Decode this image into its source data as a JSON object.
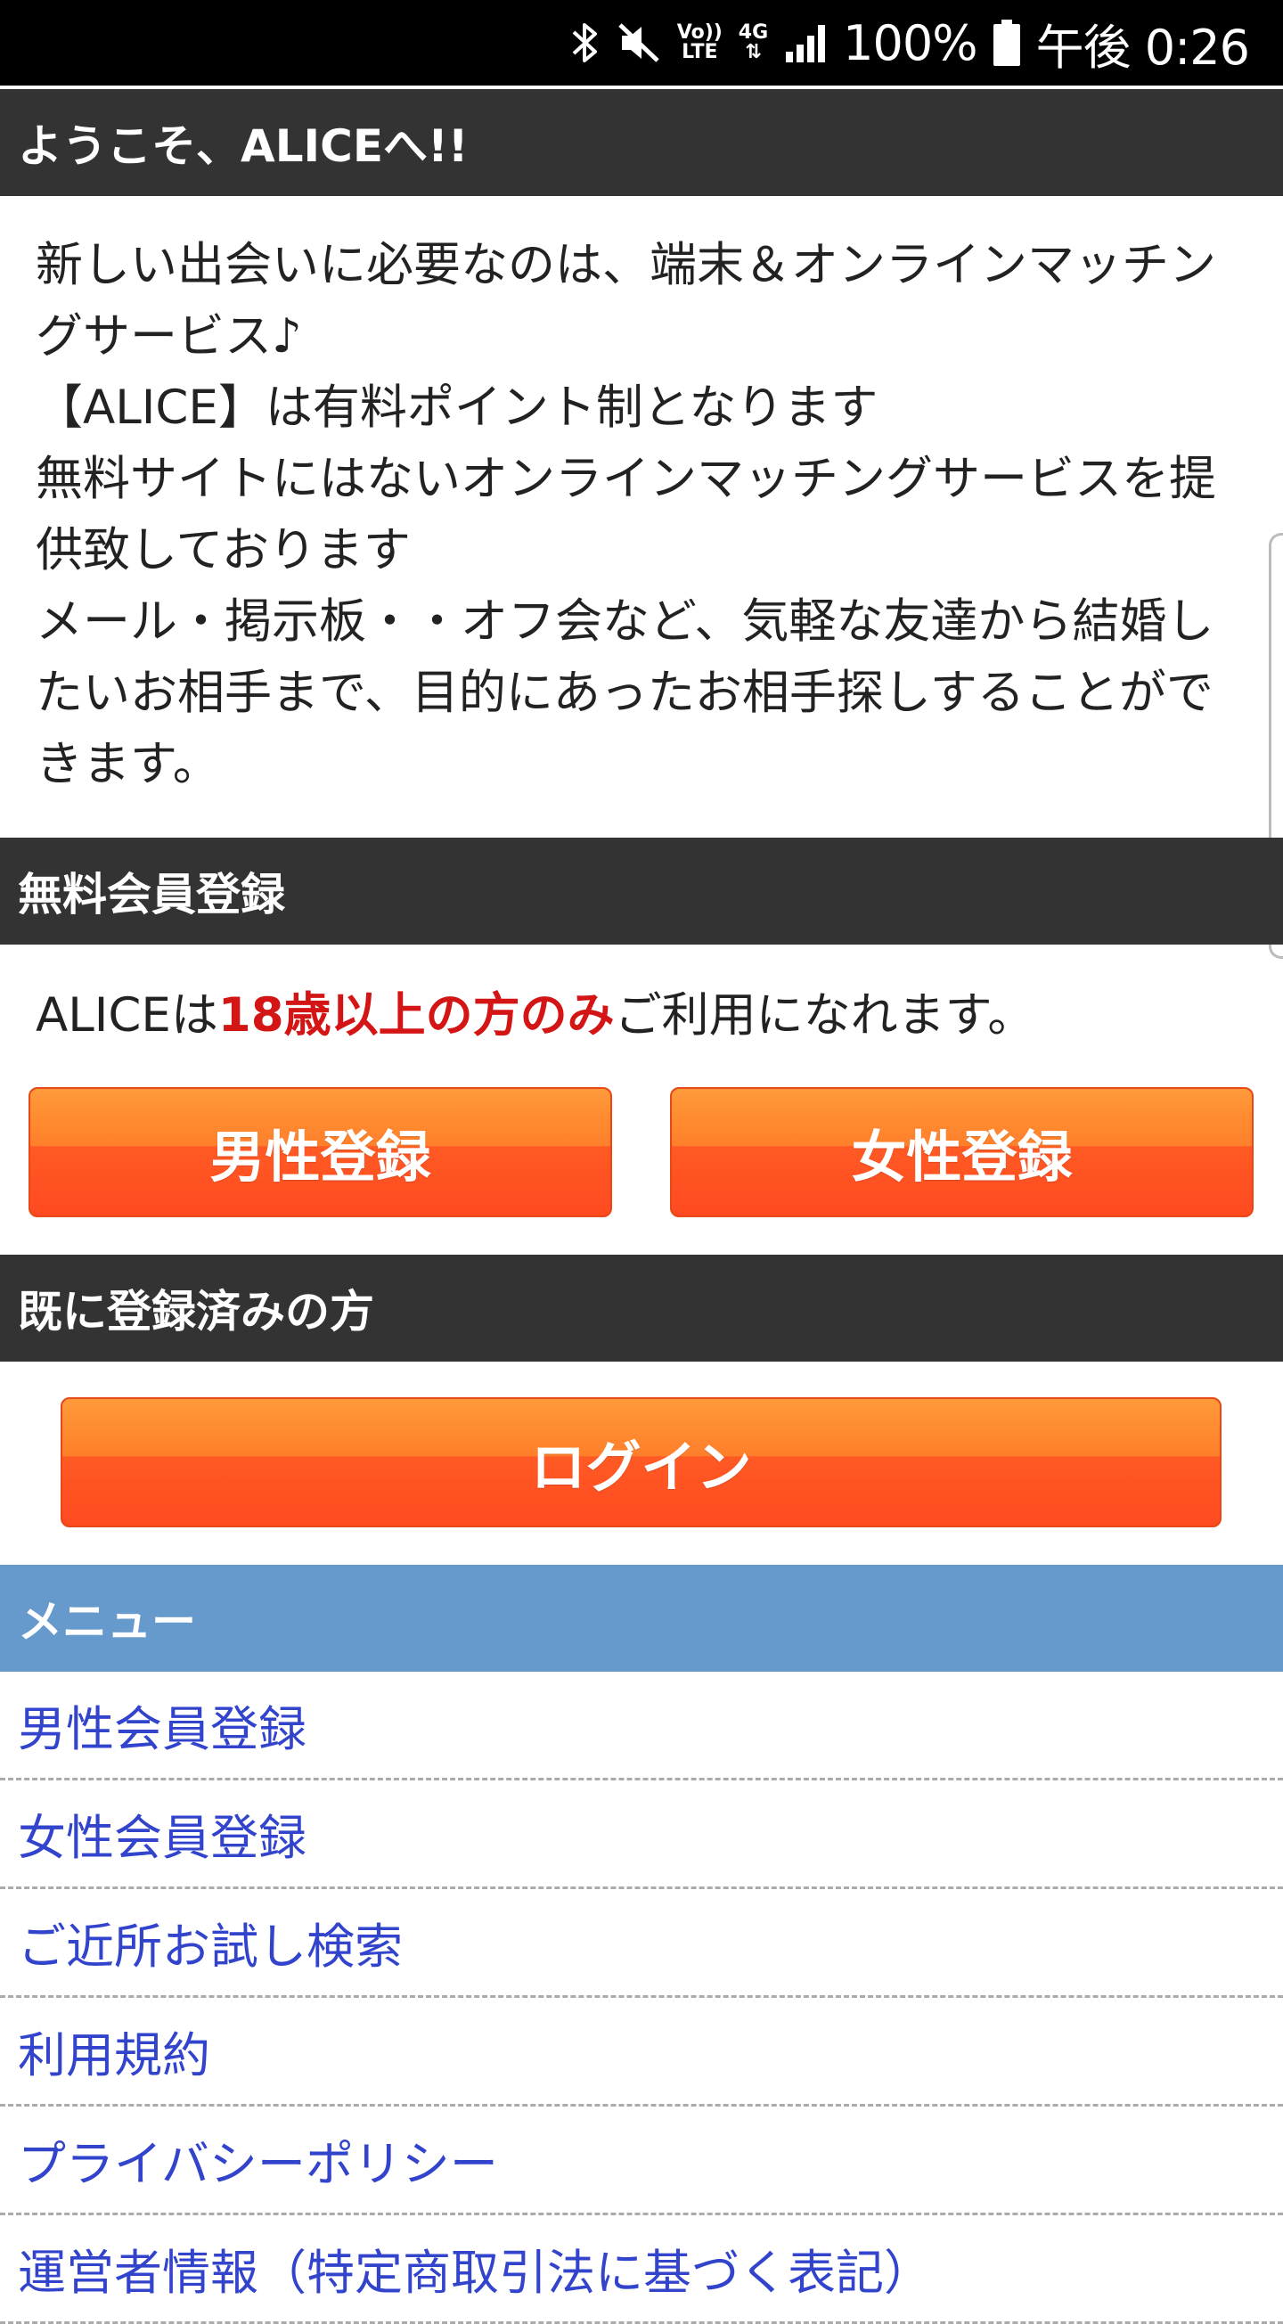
{
  "status_bar": {
    "battery_percent": "100%",
    "time": "午後 0:26",
    "volte_label_top": "Vo))",
    "volte_label_bottom": "LTE",
    "network_label": "4G",
    "icons": [
      "bluetooth-icon",
      "mute-icon",
      "volte-icon",
      "network-4g-icon",
      "signal-icon",
      "battery-icon"
    ]
  },
  "welcome": {
    "header": "ようこそ、ALICEへ!!",
    "paragraphs": [
      "新しい出会いに必要なのは、端末＆オンラインマッチングサービス♪",
      "【ALICE】は有料ポイント制となります",
      "無料サイトにはないオンラインマッチングサービスを提供致しております",
      "メール・掲示板・・オフ会など、気軽な友達から結婚したいお相手まで、目的にあったお相手探しすることができます。"
    ]
  },
  "registration": {
    "header": "無料会員登録",
    "notice_prefix": "ALICEは",
    "notice_highlight": "18歳以上の方のみ",
    "notice_suffix": "ご利用になれます。",
    "male_button": "男性登録",
    "female_button": "女性登録"
  },
  "login": {
    "header": "既に登録済みの方",
    "button": "ログイン"
  },
  "menu": {
    "header": "メニュー",
    "items": [
      "男性会員登録",
      "女性会員登録",
      "ご近所お試し検索",
      "利用規約",
      "プライバシーポリシー",
      "運営者情報（特定商取引法に基づく表記）"
    ]
  },
  "colors": {
    "header_dark": "#333333",
    "menu_header": "#6699cc",
    "button_orange": "#ff5a24",
    "highlight_red": "#d41515",
    "link_blue": "#3344cc"
  }
}
